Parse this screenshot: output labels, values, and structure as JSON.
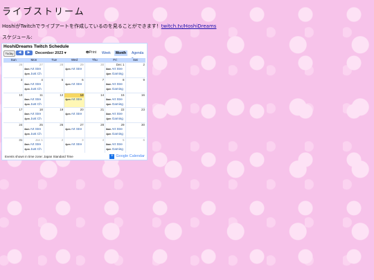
{
  "page": {
    "title": "ライブストリーム",
    "intro_text": "HoshiがTwitchでライブアートを作成しているのを見ることができます！",
    "intro_link": "twitch.tv/HoshiDreams",
    "schedule_label": "スケジュール:"
  },
  "calendar": {
    "title": "HoshiDreams Twitch Schedule",
    "today_label": "Today",
    "prev_icon": "◀",
    "next_icon": "▶",
    "month_label": "December 2023 ▾",
    "print_label": "Print",
    "tabs": [
      "Week",
      "Month",
      "Agenda ▾"
    ],
    "days_of_week": [
      "Sun",
      "Mon",
      "Tue",
      "Wed",
      "Thu",
      "Fri",
      "Sat"
    ],
    "weeks": [
      [
        {
          "n": "26"
        },
        {
          "n": "27",
          "e": [
            [
              "8am",
              "Art Stre"
            ],
            [
              "4pm",
              "Just Ch"
            ]
          ]
        },
        {
          "n": "28"
        },
        {
          "n": "29",
          "e": [
            [
              "4pm",
              "Art Stre"
            ]
          ]
        },
        {
          "n": "30"
        },
        {
          "n": "Dec 1",
          "e": [
            [
              "8am",
              "Art Stre"
            ],
            [
              "4pm",
              "Gaming"
            ]
          ]
        },
        {
          "n": "2"
        }
      ],
      [
        {
          "n": "3"
        },
        {
          "n": "4",
          "e": [
            [
              "8am",
              "Art Stre"
            ],
            [
              "4pm",
              "Just Ch"
            ]
          ]
        },
        {
          "n": "5"
        },
        {
          "n": "6",
          "e": [
            [
              "4pm",
              "Art Stre"
            ]
          ]
        },
        {
          "n": "7"
        },
        {
          "n": "8",
          "e": [
            [
              "8am",
              "Art Stre"
            ],
            [
              "4pm",
              "Gaming"
            ]
          ]
        },
        {
          "n": "9"
        }
      ],
      [
        {
          "n": "10"
        },
        {
          "n": "11",
          "e": [
            [
              "8am",
              "Art Stre"
            ],
            [
              "4pm",
              "Just Ch"
            ]
          ]
        },
        {
          "n": "12"
        },
        {
          "n": "13",
          "e": [
            [
              "4pm",
              "Art Stre"
            ]
          ]
        },
        {
          "n": "14"
        },
        {
          "n": "15",
          "e": [
            [
              "8am",
              "Art Stre"
            ],
            [
              "4pm",
              "Gaming"
            ]
          ]
        },
        {
          "n": "16"
        }
      ],
      [
        {
          "n": "17"
        },
        {
          "n": "18",
          "e": [
            [
              "8am",
              "Art Stre"
            ],
            [
              "4pm",
              "Just Ch"
            ]
          ]
        },
        {
          "n": "19"
        },
        {
          "n": "20",
          "e": [
            [
              "4pm",
              "Art Stre"
            ]
          ]
        },
        {
          "n": "21"
        },
        {
          "n": "22",
          "e": [
            [
              "8am",
              "Art Stre"
            ],
            [
              "4pm",
              "Gaming"
            ]
          ]
        },
        {
          "n": "23"
        }
      ],
      [
        {
          "n": "24"
        },
        {
          "n": "25",
          "e": [
            [
              "8am",
              "Art Stre"
            ],
            [
              "4pm",
              "Just Ch"
            ]
          ]
        },
        {
          "n": "26"
        },
        {
          "n": "27",
          "e": [
            [
              "4pm",
              "Art Stre"
            ]
          ]
        },
        {
          "n": "28"
        },
        {
          "n": "29",
          "e": [
            [
              "8am",
              "Art Stre"
            ],
            [
              "4pm",
              "Gaming"
            ]
          ]
        },
        {
          "n": "30"
        }
      ],
      [
        {
          "n": "31"
        },
        {
          "n": "Jan 1",
          "e": [
            [
              "8am",
              "Art Stre"
            ],
            [
              "4pm",
              "Just Ch"
            ]
          ]
        },
        {
          "n": "2"
        },
        {
          "n": "3",
          "e": [
            [
              "4pm",
              "Art Stre"
            ]
          ]
        },
        {
          "n": "4"
        },
        {
          "n": "5",
          "e": [
            [
              "8am",
              "Art Stre"
            ],
            [
              "4pm",
              "Gaming"
            ]
          ]
        },
        {
          "n": "6"
        }
      ]
    ],
    "other_month_cells": [
      [
        0,
        0
      ],
      [
        0,
        1
      ],
      [
        0,
        2
      ],
      [
        0,
        3
      ],
      [
        0,
        4
      ],
      [
        5,
        1
      ],
      [
        5,
        2
      ],
      [
        5,
        3
      ],
      [
        5,
        4
      ],
      [
        5,
        5
      ],
      [
        5,
        6
      ]
    ],
    "today_cell": [
      2,
      3
    ],
    "footer": "Events shown in time zone: Japan Standard Time",
    "logo_text": "Google Calendar"
  },
  "colors": {
    "background": "#f7c3ea",
    "calendar_header": "#c3d9ff",
    "today": "#fff7b5",
    "nav_button": "#4d7bd6",
    "link": "#1a0dab"
  }
}
